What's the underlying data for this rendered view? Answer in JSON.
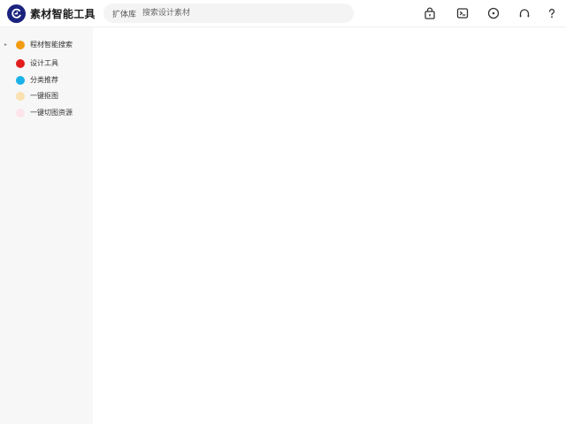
{
  "header": {
    "app_title": "素材智能工具",
    "logo_icon": "logo-icon",
    "brand_color": "#1a237e"
  },
  "search": {
    "scope_label": "扩体库",
    "placeholder": "搜索设计素材"
  },
  "toolbar": {
    "icons": [
      {
        "name": "lock-icon"
      },
      {
        "name": "message-icon"
      },
      {
        "name": "compass-icon"
      },
      {
        "name": "headphones-icon"
      },
      {
        "name": "help-icon"
      }
    ]
  },
  "sidebar": {
    "items": [
      {
        "label": "程材智能搜索",
        "color": "#f39c12",
        "has_arrow": true
      },
      {
        "label": "设计工具",
        "color": "#e51c1c",
        "has_arrow": false
      },
      {
        "label": "分类推荐",
        "color": "#1ab2e8",
        "has_arrow": false
      },
      {
        "label": "一键抠图",
        "color": "#fbe0b0",
        "has_arrow": false
      },
      {
        "label": "一键切图资源",
        "color": "#fde3ea",
        "has_arrow": false
      }
    ]
  }
}
